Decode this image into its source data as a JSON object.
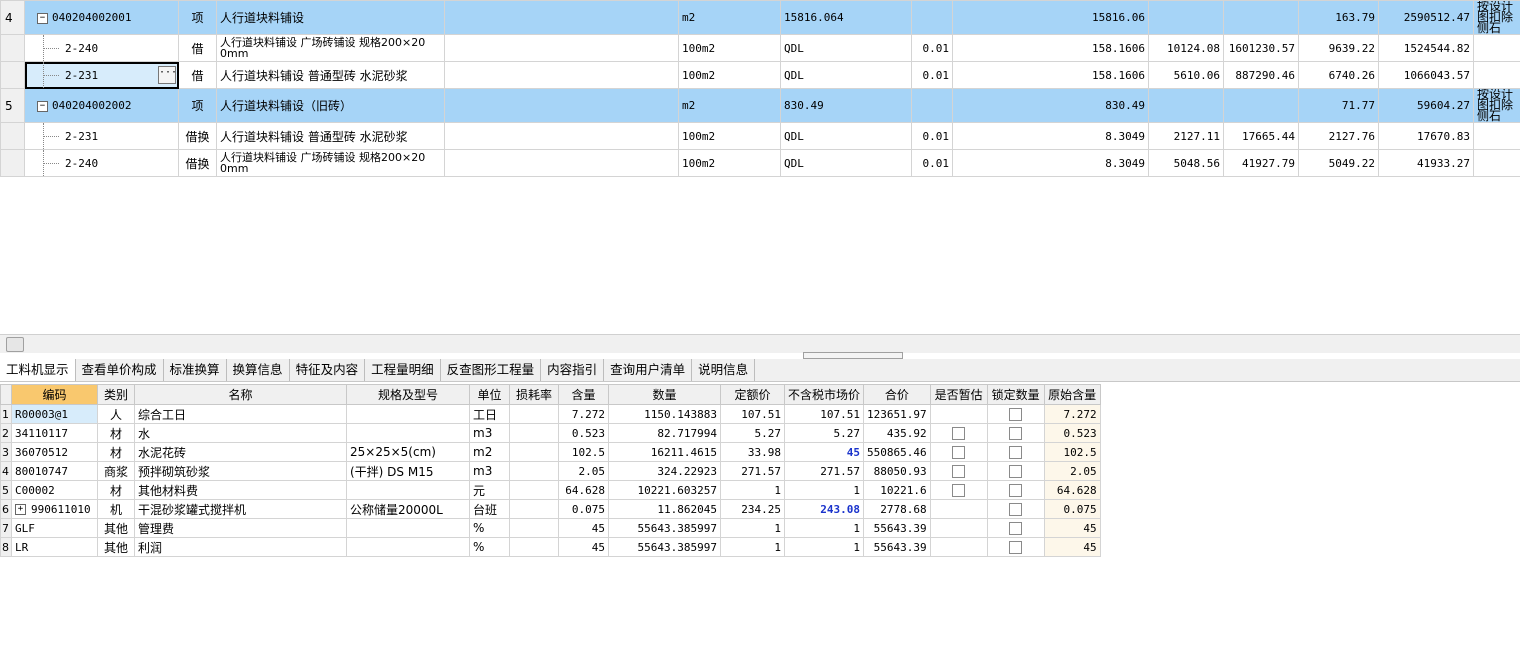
{
  "top_rows": [
    {
      "rn": "4",
      "kind": "qd",
      "code": "040204002001",
      "type": "项",
      "name": "人行道块料铺设",
      "name2": "",
      "unit": "m2",
      "expr": "15816.064",
      "content": "",
      "qty": "15816.06",
      "c1": "",
      "c2": "",
      "c3": "163.79",
      "c4": "2590512.47",
      "note": "按设计图扣除侧石"
    },
    {
      "rn": "",
      "kind": "de",
      "code": "2-240",
      "type": "借",
      "name": "人行道块料铺设 广场砖铺设 规格200×20",
      "name2": "0mm",
      "unit": "100m2",
      "expr": "QDL",
      "content": "0.01",
      "qty": "158.1606",
      "c1": "10124.08",
      "c2": "1601230.57",
      "c3": "9639.22",
      "c4": "1524544.82",
      "note": ""
    },
    {
      "rn": "",
      "kind": "de",
      "sel": true,
      "code": "2-231",
      "type": "借",
      "name": "人行道块料铺设 普通型砖 水泥砂浆",
      "name2": "",
      "unit": "100m2",
      "expr": "QDL",
      "content": "0.01",
      "qty": "158.1606",
      "c1": "5610.06",
      "c2": "887290.46",
      "c3": "6740.26",
      "c4": "1066043.57",
      "note": ""
    },
    {
      "rn": "5",
      "kind": "qd",
      "code": "040204002002",
      "type": "项",
      "name": "人行道块料铺设（旧砖）",
      "name2": "",
      "unit": "m2",
      "expr": "830.49",
      "content": "",
      "qty": "830.49",
      "c1": "",
      "c2": "",
      "c3": "71.77",
      "c4": "59604.27",
      "note": "按设计图扣除侧石"
    },
    {
      "rn": "",
      "kind": "de",
      "code": "2-231",
      "type": "借换",
      "name": "人行道块料铺设 普通型砖 水泥砂浆",
      "name2": "",
      "unit": "100m2",
      "expr": "QDL",
      "content": "0.01",
      "qty": "8.3049",
      "c1": "2127.11",
      "c2": "17665.44",
      "c3": "2127.76",
      "c4": "17670.83",
      "note": ""
    },
    {
      "rn": "",
      "kind": "de",
      "code": "2-240",
      "type": "借换",
      "name": "人行道块料铺设 广场砖铺设 规格200×20",
      "name2": "0mm",
      "unit": "100m2",
      "expr": "QDL",
      "content": "0.01",
      "qty": "8.3049",
      "c1": "5048.56",
      "c2": "41927.79",
      "c3": "5049.22",
      "c4": "41933.27",
      "note": ""
    }
  ],
  "tabs": [
    "工料机显示",
    "查看单价构成",
    "标准换算",
    "换算信息",
    "特征及内容",
    "工程量明细",
    "反查图形工程量",
    "内容指引",
    "查询用户清单",
    "说明信息"
  ],
  "res_headers": [
    "编码",
    "类别",
    "名称",
    "规格及型号",
    "单位",
    "损耗率",
    "含量",
    "数量",
    "定额价",
    "不含税市场价",
    "合价",
    "是否暂估",
    "锁定数量",
    "原始含量"
  ],
  "res_rows": [
    {
      "rn": "1",
      "code": "R00003@1",
      "cat": "人",
      "name": "综合工日",
      "spec": "",
      "unit": "工日",
      "loss": "",
      "content": "7.272",
      "qty": "1150.143883",
      "price": "107.51",
      "market": "107.51",
      "total": "123651.97",
      "est": false,
      "lock": true,
      "orig": "7.272"
    },
    {
      "rn": "2",
      "code": "34110117",
      "cat": "材",
      "name": "水",
      "spec": "",
      "unit": "m3",
      "loss": "",
      "content": "0.523",
      "qty": "82.717994",
      "price": "5.27",
      "market": "5.27",
      "total": "435.92",
      "est": true,
      "lock": true,
      "orig": "0.523"
    },
    {
      "rn": "3",
      "code": "36070512",
      "cat": "材",
      "name": "水泥花砖",
      "spec": "25×25×5(cm)",
      "unit": "m2",
      "loss": "",
      "content": "102.5",
      "qty": "16211.4615",
      "price": "33.98",
      "market": "45",
      "blue": true,
      "total": "550865.46",
      "est": true,
      "lock": true,
      "orig": "102.5"
    },
    {
      "rn": "4",
      "code": "80010747",
      "cat": "商浆",
      "name": "预拌砌筑砂浆",
      "spec": "(干拌) DS M15",
      "unit": "m3",
      "loss": "",
      "content": "2.05",
      "qty": "324.22923",
      "price": "271.57",
      "market": "271.57",
      "total": "88050.93",
      "est": true,
      "lock": true,
      "orig": "2.05"
    },
    {
      "rn": "5",
      "code": "C00002",
      "cat": "材",
      "name": "其他材料费",
      "spec": "",
      "unit": "元",
      "loss": "",
      "content": "64.628",
      "qty": "10221.603257",
      "price": "1",
      "market": "1",
      "total": "10221.6",
      "est": true,
      "lock": true,
      "orig": "64.628"
    },
    {
      "rn": "6",
      "code": "990611010",
      "cat": "机",
      "name": "干混砂浆罐式搅拌机",
      "spec": "公称储量20000L",
      "unit": "台班",
      "loss": "",
      "content": "0.075",
      "qty": "11.862045",
      "price": "234.25",
      "market": "243.08",
      "blue": true,
      "total": "2778.68",
      "est": false,
      "lock": true,
      "orig": "0.075",
      "expand": true
    },
    {
      "rn": "7",
      "code": "GLF",
      "cat": "其他",
      "name": "管理费",
      "spec": "",
      "unit": "%",
      "loss": "",
      "content": "45",
      "qty": "55643.385997",
      "price": "1",
      "market": "1",
      "total": "55643.39",
      "est": false,
      "lock": true,
      "orig": "45"
    },
    {
      "rn": "8",
      "code": "LR",
      "cat": "其他",
      "name": "利润",
      "spec": "",
      "unit": "%",
      "loss": "",
      "content": "45",
      "qty": "55643.385997",
      "price": "1",
      "market": "1",
      "total": "55643.39",
      "est": false,
      "lock": true,
      "orig": "45"
    }
  ]
}
